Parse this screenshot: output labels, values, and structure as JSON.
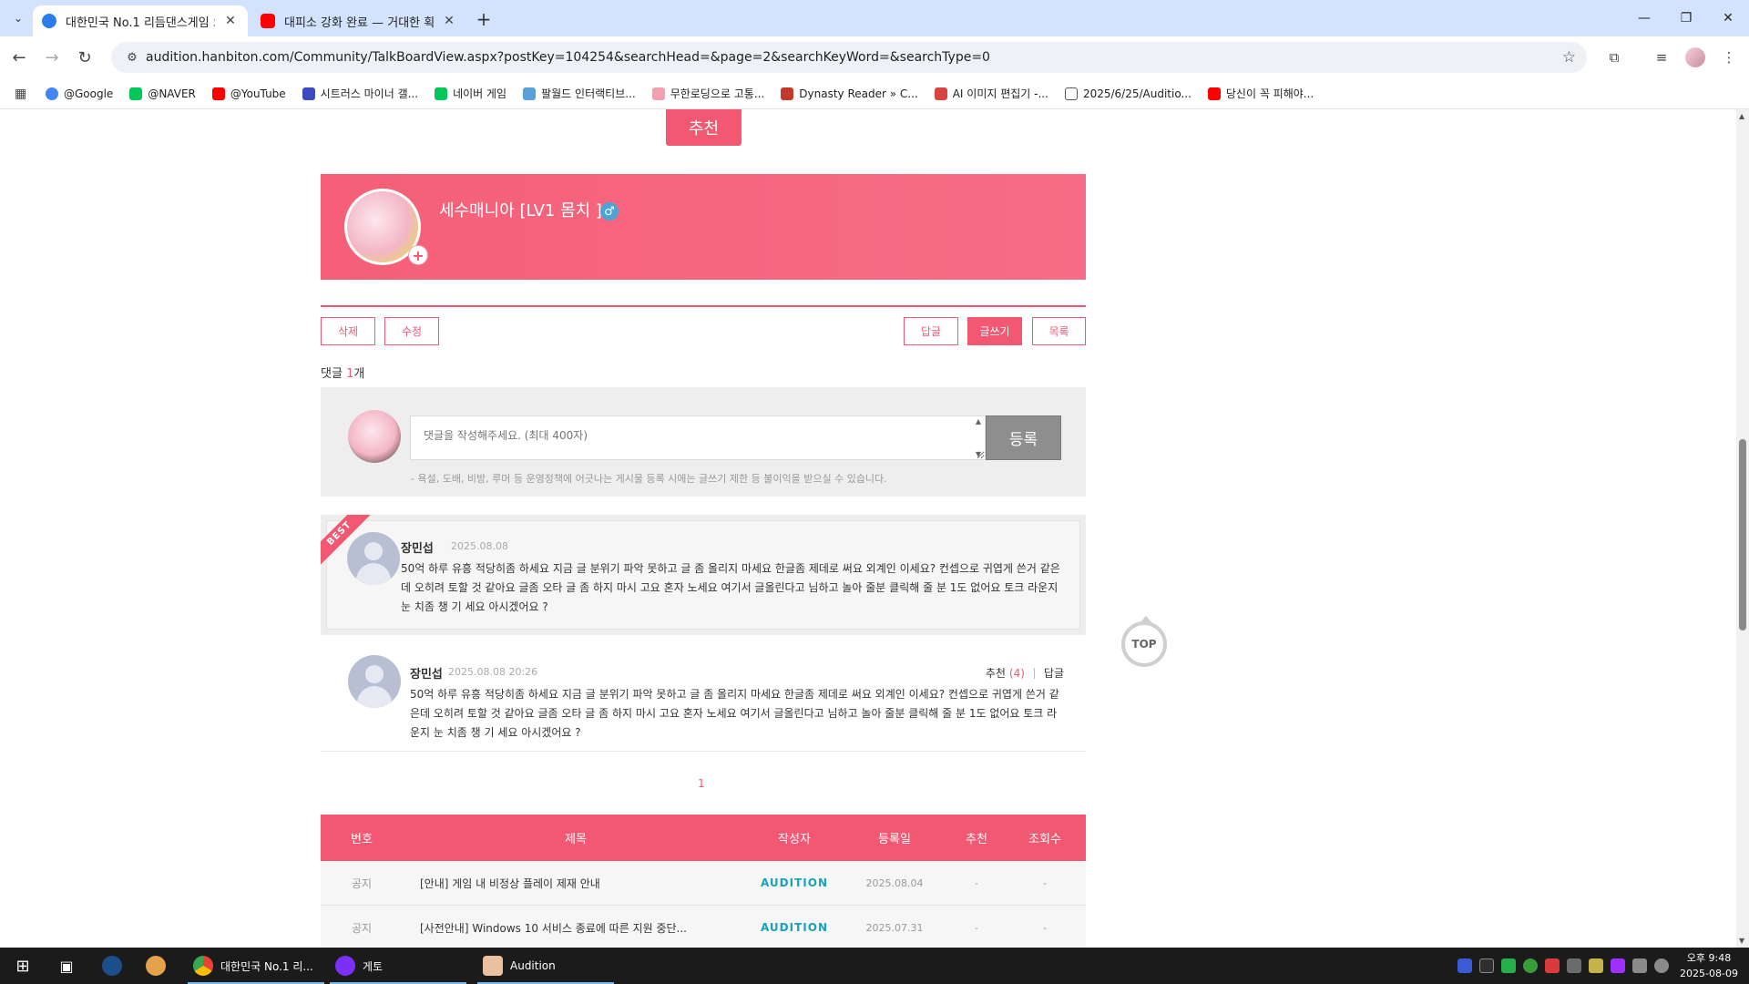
{
  "browser": {
    "tabs": [
      {
        "title": "대한민국 No.1 리듬댄스게임 오"
      },
      {
        "title": "대피소 강화 완료 — 거대한 획"
      }
    ],
    "url": "audition.hanbiton.com/Community/TalkBoardView.aspx?postKey=104254&searchHead=&page=2&searchKeyWord=&searchType=0",
    "bookmarks": [
      {
        "label": "@Google",
        "color": "#4285f4"
      },
      {
        "label": "@NAVER",
        "color": "#03c75a"
      },
      {
        "label": "@YouTube",
        "color": "#ff0000"
      },
      {
        "label": "시트러스 마이너 갤...",
        "color": "#3b4cc0"
      },
      {
        "label": "네이버 게임",
        "color": "#03c75a"
      },
      {
        "label": "팔월드 인터랙티브...",
        "color": "#5aa0d8"
      },
      {
        "label": "무한로딩으로 고통...",
        "color": "#f0a0b0"
      },
      {
        "label": "Dynasty Reader » C...",
        "color": "#c0392b"
      },
      {
        "label": "AI 이미지 편집기 -...",
        "color": "#d64541"
      },
      {
        "label": "2025/6/25/Auditio...",
        "color": "#555555"
      },
      {
        "label": "당신이 꼭 피해야...",
        "color": "#ff0000"
      }
    ]
  },
  "post": {
    "recommend_label": "추천",
    "author_name": "세수매니아 [LV1 몸치 ]",
    "gender_icon": "♂"
  },
  "actions": {
    "delete": "삭제",
    "edit": "수정",
    "reply": "답글",
    "write": "글쓰기",
    "list": "목록"
  },
  "comments": {
    "count_prefix": "댓글 ",
    "count": "1",
    "count_suffix": "개",
    "placeholder": "댓글을 작성해주세요. (최대 400자)",
    "submit": "등록",
    "notice": "- 욕설, 도배, 비방, 루머 등 운영정책에 어긋나는 게시물 등록 시에는 글쓰기 제한 등 불이익을 받으실 수 있습니다.",
    "best": {
      "badge": "BEST",
      "author": "장민섭",
      "date": "2025.08.08",
      "text": "50억 하루 유흥 적당히좀 하세요 지금 글 분위기 파악 못하고 글 좀 올리지 마세요 한글좀 제데로 써요 외계인 이세요? 컨셉으로 귀엽게 쓴거 같은데 오히려 토할 것 같아요 글좀 오타 글 좀 하지 마시 고요 혼자 노세요 여기서 글올린다고 님하고 놀아 줄분 클릭해 줄 분 1도 없어요 토크 라운지 눈 치좀 챙 기 세요 아시겠어요 ?"
    },
    "items": [
      {
        "author": "장민섭",
        "date": "2025.08.08 20:26",
        "recommend_label": "추천",
        "recommend_count": "(4)",
        "reply_label": "답글",
        "text": "50억 하루 유흥 적당히좀 하세요 지금 글 분위기 파악 못하고 글 좀 올리지 마세요 한글좀 제데로 써요 외계인 이세요? 컨셉으로 귀엽게 쓴거 같은데 오히려 토할 것 같아요 글좀 오타 글 좀 하지 마시 고요 혼자 노세요 여기서 글올린다고 님하고 놀아 줄분 클릭해 줄 분 1도 없어요 토크 라운지 눈 치좀 챙 기 세요 아시겠어요 ?"
      }
    ],
    "page": "1"
  },
  "board": {
    "headers": {
      "num": "번호",
      "title": "제목",
      "author": "작성자",
      "date": "등록일",
      "recommend": "추천",
      "views": "조회수"
    },
    "rows": [
      {
        "num": "공지",
        "title": "[안내] 게임 내 비정상 플레이 제재 안내",
        "author": "AUDITION",
        "date": "2025.08.04",
        "recommend": "-",
        "views": "-"
      },
      {
        "num": "공지",
        "title": "[사전안내] Windows 10 서비스 종료에 따른 지원 중단...",
        "author": "AUDITION",
        "date": "2025.07.31",
        "recommend": "-",
        "views": "-"
      }
    ]
  },
  "top_button": "TOP",
  "taskbar": {
    "apps": [
      {
        "label": "대한민국 No.1 리..."
      },
      {
        "label": "게토"
      },
      {
        "label": "Audition"
      }
    ],
    "time": "오후 9:48",
    "date": "2025-08-09"
  },
  "colors": {
    "accent": "#f35873",
    "tab_strip": "#d3e3fd",
    "audition_brand": "#1aa3b8"
  }
}
